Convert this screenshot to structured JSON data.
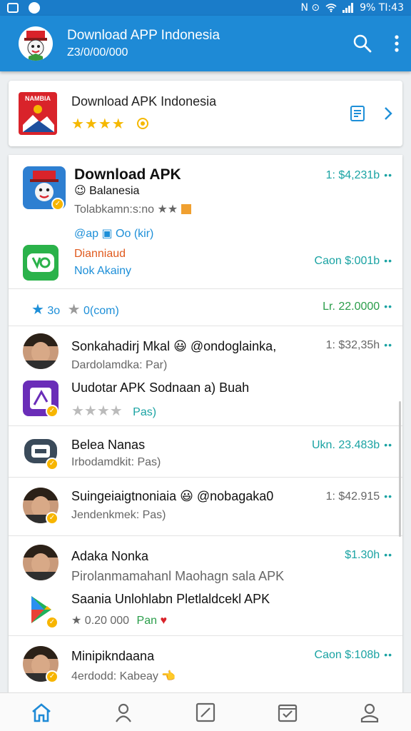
{
  "status_bar": {
    "indicators": "N ⊙",
    "right_text": "9% TI:43"
  },
  "app_bar": {
    "title": "Download APP Indonesia",
    "subtitle": "Z3/0/00/000",
    "icons": [
      "search-icon",
      "more-vert-icon"
    ]
  },
  "featured": {
    "icon_label": "NAMBIA",
    "title": "Download APK Indonesia",
    "stars": "★★★★",
    "icons": [
      "bookmark-icon",
      "chevron-right-icon"
    ]
  },
  "list": {
    "item1": {
      "title": "Download APK",
      "subtitle": "😉 Balanesia",
      "meta": "Tolabkamn:s:no ★★",
      "tags": "@ap  ▣ Oo (kir)",
      "price": "1: $4,231b",
      "sub_title": "Dianniaud",
      "sub_label": "Nok Akainy",
      "sub_price": "Caon $:001b"
    },
    "rating_row": {
      "rating": "3o",
      "other": "0(com)",
      "price": "Lr. 22.0000"
    },
    "item2": {
      "name": "Sonkahadirj Mkal 😃 @ondoglainka,",
      "sub": "Dardolamdka: Par)",
      "price": "1: $32,35h",
      "app_title": "Uudotar APK Sodnaan a) Buah",
      "app_tag": "Pas)"
    },
    "item3": {
      "name": "Belea Nanas",
      "sub": "Irbodamdkit: Pas)",
      "price": "Ukn. 23.483b"
    },
    "item4": {
      "name": "Suingeiaigtnoniaia 😃 @nobagaka0",
      "sub": "Jendenkmek: Pas)",
      "price": "1: $42.915"
    },
    "item5": {
      "name": "Adaka Nonka",
      "sub": "Pirolanmamahanl Maohagn sala APK",
      "price": "$1.30h",
      "app_title": "Saania Unlohlabn Pletlaldcekl APK",
      "app_meta": "★ 0.20 000",
      "app_tag": "Pan"
    },
    "item6": {
      "name": "Minipikndaana",
      "sub": "4erdodd: Kabeay 👈",
      "price": "Caon $:108b"
    }
  },
  "bottom_nav": [
    "home-icon",
    "profile-icon",
    "edit-icon",
    "checklist-icon",
    "account-icon"
  ],
  "colors": {
    "primary": "#1e8ad6",
    "accent_star": "#f5b800",
    "teal": "#1aa3a3"
  }
}
